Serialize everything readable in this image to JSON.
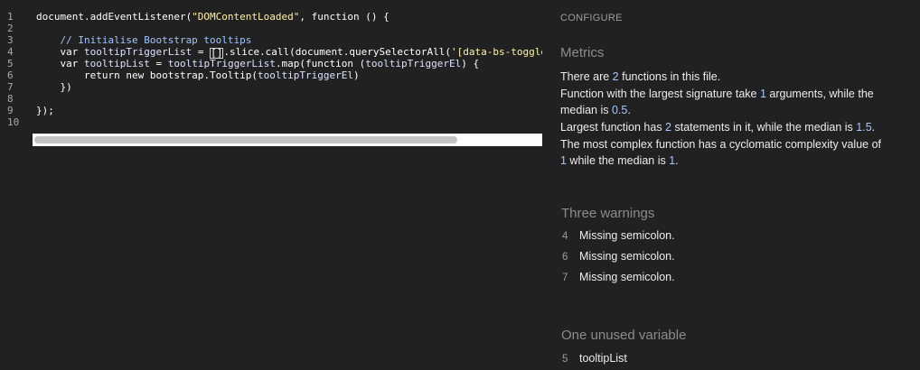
{
  "editor": {
    "line_numbers": [
      "1",
      "2",
      "3",
      "4",
      "5",
      "6",
      "7",
      "8",
      "9",
      "10"
    ],
    "lines": [
      [
        {
          "t": "document.addEventListener(",
          "c": "plain"
        },
        {
          "t": "\"DOMContentLoaded\"",
          "c": "str"
        },
        {
          "t": ", function () {",
          "c": "plain"
        }
      ],
      [],
      [
        {
          "t": "    // Initialise Bootstrap tooltips",
          "c": "cmt"
        }
      ],
      [
        {
          "t": "    var ",
          "c": "plain"
        },
        {
          "t": "tooltipTriggerList",
          "c": "var"
        },
        {
          "t": " = ",
          "c": "plain"
        },
        {
          "t": "[]",
          "c": "bracket"
        },
        {
          "t": ".slice.call(document.querySelectorAll(",
          "c": "plain"
        },
        {
          "t": "'[data-bs-toggle=\"tooltip\"]'",
          "c": "str"
        },
        {
          "t": "))",
          "c": "plain"
        }
      ],
      [
        {
          "t": "    var ",
          "c": "plain"
        },
        {
          "t": "tooltipList",
          "c": "var"
        },
        {
          "t": " = ",
          "c": "plain"
        },
        {
          "t": "tooltipTriggerList",
          "c": "var"
        },
        {
          "t": ".map(function (",
          "c": "plain"
        },
        {
          "t": "tooltipTriggerEl",
          "c": "var"
        },
        {
          "t": ") {",
          "c": "plain"
        }
      ],
      [
        {
          "t": "        return new bootstrap.Tooltip(",
          "c": "plain"
        },
        {
          "t": "tooltipTriggerEl",
          "c": "var"
        },
        {
          "t": ")",
          "c": "plain"
        }
      ],
      [
        {
          "t": "    })",
          "c": "plain"
        }
      ],
      [],
      [
        {
          "t": "});",
          "c": "plain"
        }
      ],
      []
    ],
    "scroll_position": 0.0
  },
  "panel": {
    "configure_label": "CONFIGURE",
    "metrics": {
      "title": "Metrics",
      "paragraphs": [
        [
          {
            "t": "There are "
          },
          {
            "t": "2",
            "n": true
          },
          {
            "t": " functions in this file."
          }
        ],
        [
          {
            "t": "Function with the largest signature take "
          },
          {
            "t": "1",
            "n": true
          },
          {
            "t": " arguments, while the median is "
          },
          {
            "t": "0.5",
            "n": true
          },
          {
            "t": "."
          }
        ],
        [
          {
            "t": "Largest function has "
          },
          {
            "t": "2",
            "n": true
          },
          {
            "t": " statements in it, while the median is "
          },
          {
            "t": "1.5",
            "n": true
          },
          {
            "t": "."
          }
        ],
        [
          {
            "t": "The most complex function has a cyclomatic complexity value of "
          },
          {
            "t": "1",
            "n": true
          },
          {
            "t": " while the median is "
          },
          {
            "t": "1",
            "n": true
          },
          {
            "t": "."
          }
        ]
      ]
    },
    "warnings": {
      "title": "Three warnings",
      "items": [
        {
          "line": "4",
          "message": "Missing semicolon."
        },
        {
          "line": "6",
          "message": "Missing semicolon."
        },
        {
          "line": "7",
          "message": "Missing semicolon."
        }
      ]
    },
    "unused": {
      "title": "One unused variable",
      "items": [
        {
          "line": "5",
          "name": "tooltipList"
        }
      ]
    }
  },
  "colors": {
    "background": "#212121",
    "number_accent": "#a7c7ff",
    "string": "#fff3a8",
    "comment": "#9fc4ff"
  }
}
